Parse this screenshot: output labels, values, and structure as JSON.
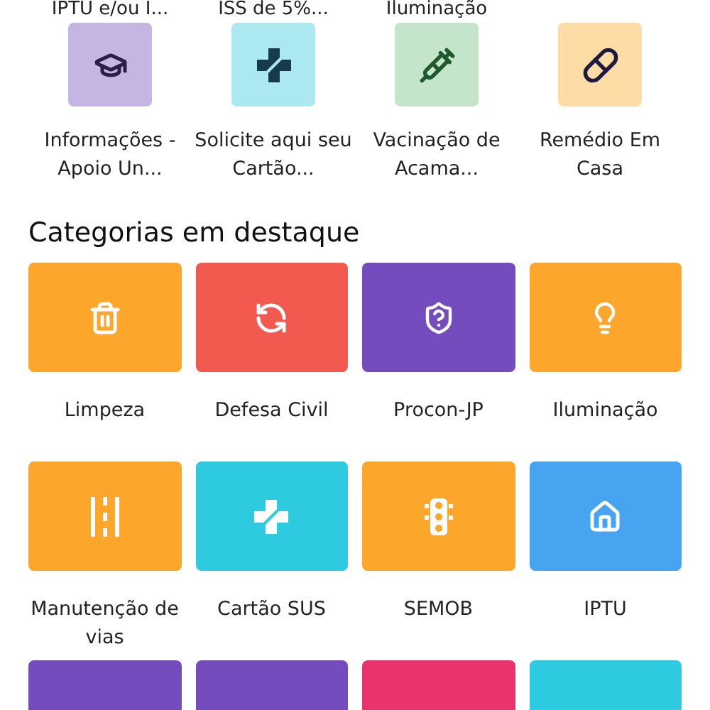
{
  "previous_row_labels": [
    "IPTU e/ou I...",
    "ISS de 5%...",
    "Iluminação"
  ],
  "services": [
    {
      "label": "Informações - Apoio Un...",
      "color": "#c5b5e3"
    },
    {
      "label": "Solicite aqui seu Cartão...",
      "color": "#ace8f0"
    },
    {
      "label": "Vacinação de Acama...",
      "color": "#c4e5c9"
    },
    {
      "label": "Remédio Em Casa",
      "color": "#fddca6"
    }
  ],
  "featured": {
    "title": "Categorias em destaque",
    "categories": [
      {
        "label": "Limpeza",
        "color": "#fca62b"
      },
      {
        "label": "Defesa Civil",
        "color": "#f25a50"
      },
      {
        "label": "Procon-JP",
        "color": "#744cbd"
      },
      {
        "label": "Iluminação",
        "color": "#fca62b"
      },
      {
        "label": "Manutenção de vias",
        "color": "#fca62b"
      },
      {
        "label": "Cartão SUS",
        "color": "#2ecbe0"
      },
      {
        "label": "SEMOB",
        "color": "#fca62b"
      },
      {
        "label": "IPTU",
        "color": "#46a4f0"
      },
      {
        "color": "#744cbd"
      },
      {
        "color": "#744cbd"
      },
      {
        "color": "#ea336d"
      },
      {
        "color": "#2ecbe0"
      }
    ]
  }
}
